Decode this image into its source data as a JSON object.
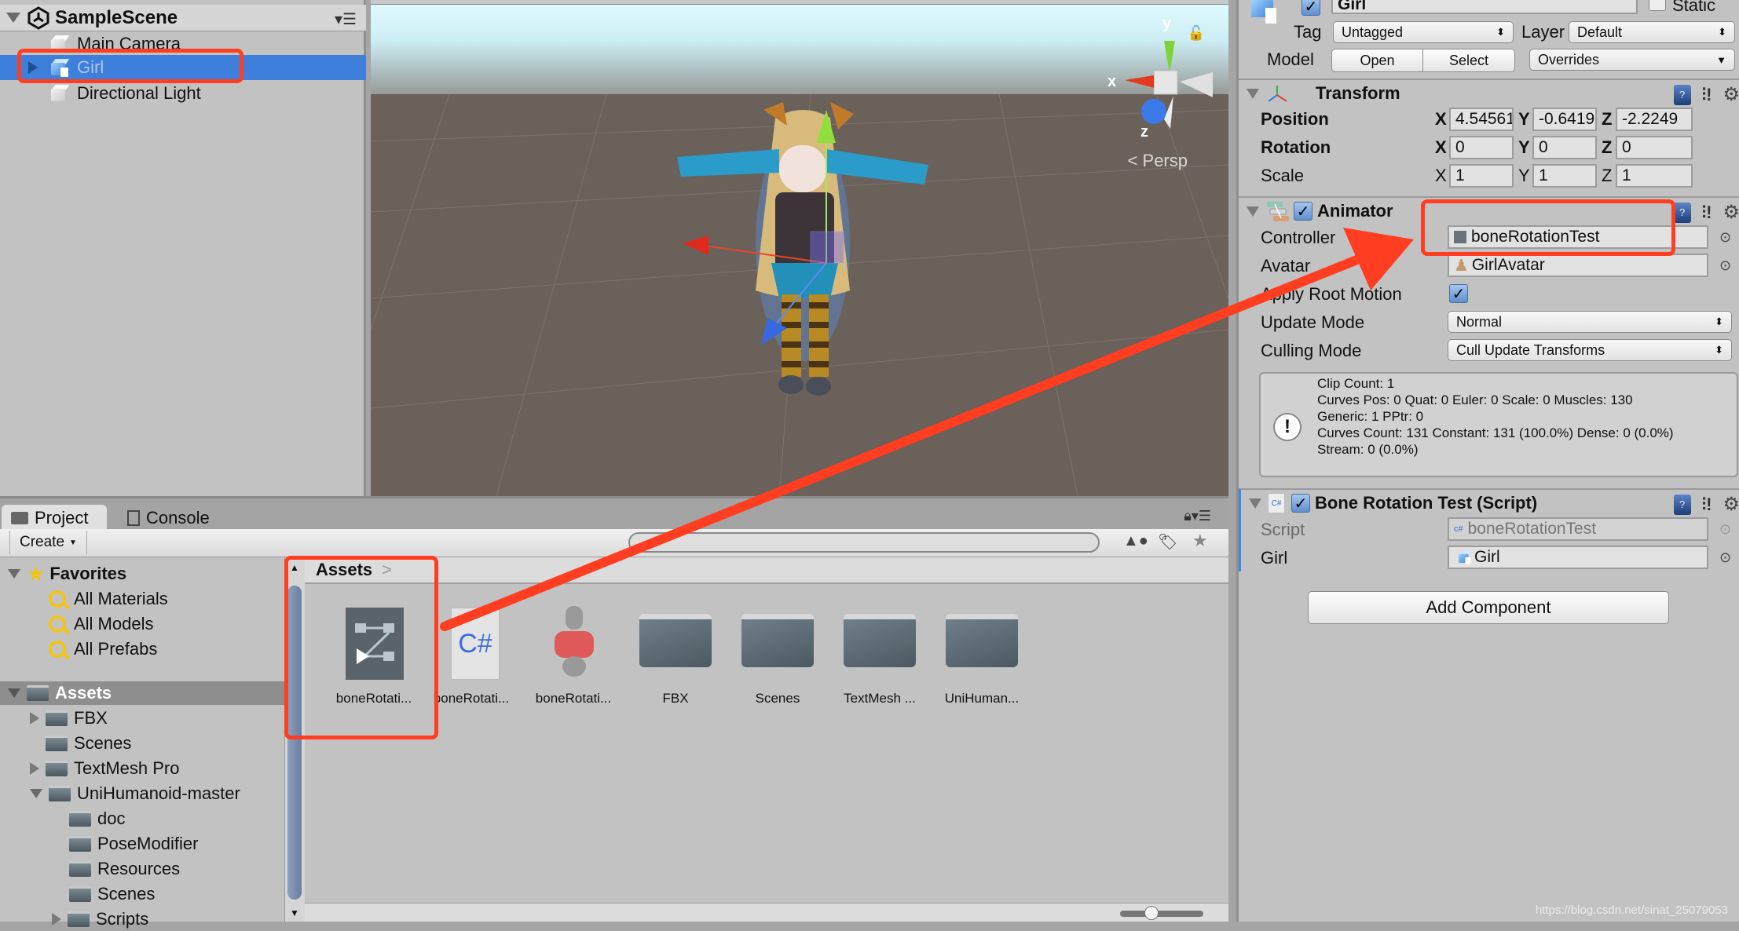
{
  "hierarchy": {
    "scene_name": "SampleScene",
    "items": [
      {
        "label": "Main Camera",
        "selected": false
      },
      {
        "label": "Girl",
        "selected": true
      },
      {
        "label": "Directional Light",
        "selected": false
      }
    ]
  },
  "scene_view": {
    "axis_labels": {
      "x": "x",
      "y": "y",
      "z": "z"
    },
    "projection_label": "Persp"
  },
  "inspector": {
    "object_name": "Girl",
    "static_label": "Static",
    "tag_label": "Tag",
    "tag_value": "Untagged",
    "layer_label": "Layer",
    "layer_value": "Default",
    "model_label": "Model",
    "open_label": "Open",
    "select_label": "Select",
    "overrides_label": "Overrides",
    "transform": {
      "title": "Transform",
      "position_label": "Position",
      "rotation_label": "Rotation",
      "scale_label": "Scale",
      "axis_x": "X",
      "axis_y": "Y",
      "axis_z": "Z",
      "position": {
        "x": "4.54561",
        "y": "-0.6419",
        "z": "-2.2249"
      },
      "rotation": {
        "x": "0",
        "y": "0",
        "z": "0"
      },
      "scale": {
        "x": "1",
        "y": "1",
        "z": "1"
      }
    },
    "animator": {
      "title": "Animator",
      "enabled": true,
      "controller_label": "Controller",
      "controller_value": "boneRotationTest",
      "avatar_label": "Avatar",
      "avatar_value": "GirlAvatar",
      "root_motion_label": "Apply Root Motion",
      "root_motion_checked": true,
      "update_mode_label": "Update Mode",
      "update_mode_value": "Normal",
      "culling_mode_label": "Culling Mode",
      "culling_mode_value": "Cull Update Transforms",
      "info_lines": [
        "Clip Count: 1",
        "Curves Pos: 0 Quat: 0 Euler: 0 Scale: 0 Muscles: 130",
        "Generic: 1 PPtr: 0",
        "Curves Count: 131 Constant: 131 (100.0%) Dense: 0 (0.0%)",
        "Stream: 0 (0.0%)"
      ]
    },
    "script_component": {
      "title": "Bone Rotation Test (Script)",
      "enabled": true,
      "script_label": "Script",
      "script_value": "boneRotationTest",
      "girl_label": "Girl",
      "girl_value": "Girl"
    },
    "add_component_label": "Add Component"
  },
  "project": {
    "tabs": [
      {
        "label": "Project",
        "active": true
      },
      {
        "label": "Console",
        "active": false
      }
    ],
    "create_label": "Create",
    "search_value": "",
    "favorites": {
      "title": "Favorites",
      "items": [
        "All Materials",
        "All Models",
        "All Prefabs"
      ]
    },
    "tree": [
      {
        "label": "Assets",
        "depth": 0,
        "expander": "open",
        "selected": true
      },
      {
        "label": "FBX",
        "depth": 1,
        "expander": "closed"
      },
      {
        "label": "Scenes",
        "depth": 1,
        "expander": "none"
      },
      {
        "label": "TextMesh Pro",
        "depth": 1,
        "expander": "closed"
      },
      {
        "label": "UniHumanoid-master",
        "depth": 1,
        "expander": "open"
      },
      {
        "label": "doc",
        "depth": 2,
        "expander": "none"
      },
      {
        "label": "PoseModifier",
        "depth": 2,
        "expander": "none"
      },
      {
        "label": "Resources",
        "depth": 2,
        "expander": "none"
      },
      {
        "label": "Scenes",
        "depth": 2,
        "expander": "none"
      },
      {
        "label": "Scripts",
        "depth": 2,
        "expander": "closed"
      }
    ],
    "breadcrumb": "Assets",
    "assets": [
      {
        "label": "boneRotati...",
        "type": "animator-controller"
      },
      {
        "label": "boneRotati...",
        "type": "csharp-script"
      },
      {
        "label": "boneRotati...",
        "type": "avatar-mask"
      },
      {
        "label": "FBX",
        "type": "folder"
      },
      {
        "label": "Scenes",
        "type": "folder"
      },
      {
        "label": "TextMesh ...",
        "type": "folder"
      },
      {
        "label": "UniHuman...",
        "type": "folder"
      }
    ],
    "icon_size_fraction": 0.35
  },
  "annotation_color": "#ff3d20",
  "watermark": "https://blog.csdn.net/sinat_25079053"
}
